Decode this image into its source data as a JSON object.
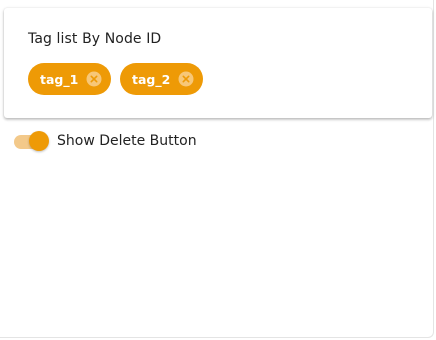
{
  "card": {
    "title": "Tag list By Node ID",
    "tags": [
      {
        "label": "tag_1",
        "delete_icon": "close-circle-icon"
      },
      {
        "label": "tag_2",
        "delete_icon": "close-circle-icon"
      }
    ]
  },
  "toggle": {
    "label": "Show Delete Button",
    "checked": true
  },
  "colors": {
    "accent": "#ee9a06",
    "toggle_track": "#f3c98a",
    "text": "#222222"
  }
}
